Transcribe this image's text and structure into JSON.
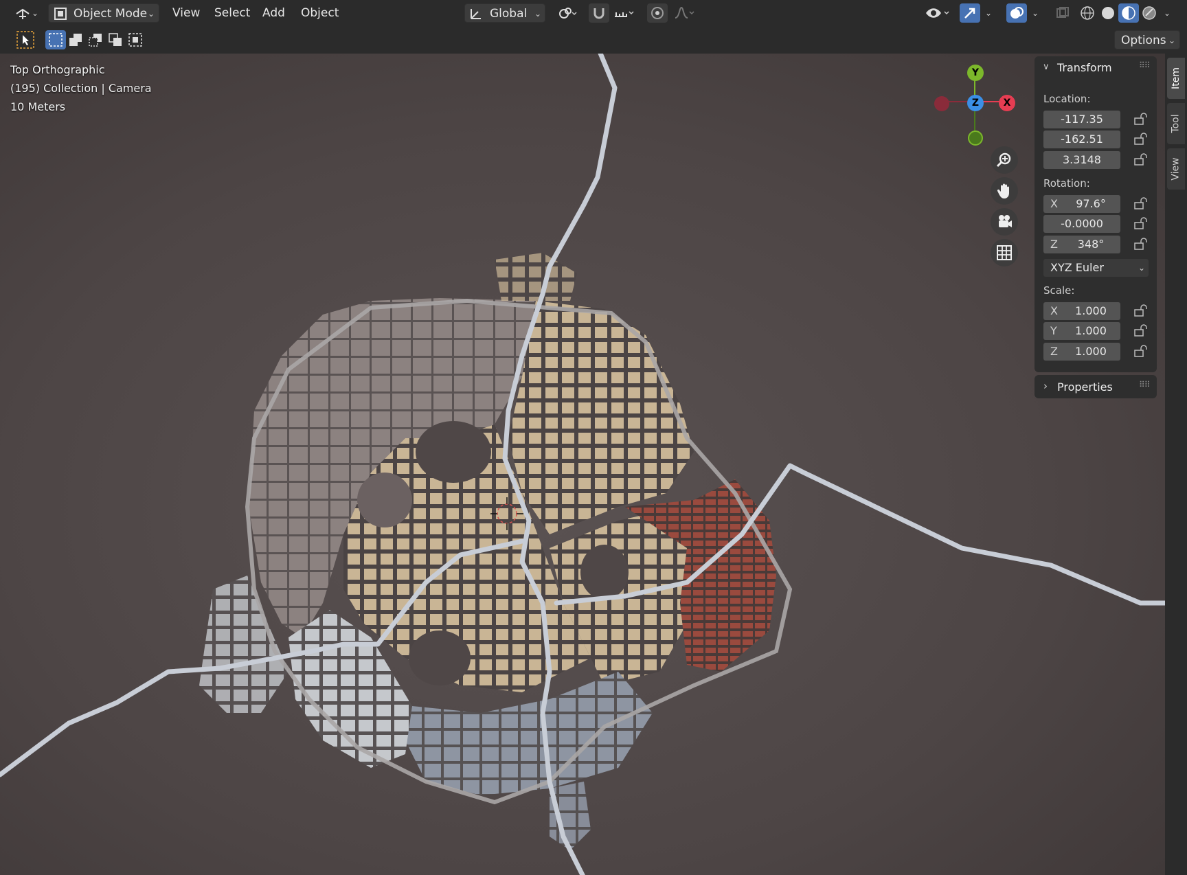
{
  "header": {
    "mode": "Object Mode",
    "menus": [
      "View",
      "Select",
      "Add",
      "Object"
    ],
    "orientation": "Global"
  },
  "toolbar": {
    "options": "Options"
  },
  "viewport": {
    "view_name": "Top Orthographic",
    "collection": "(195) Collection | Camera",
    "scale": "10 Meters"
  },
  "gizmo": {
    "y": "Y",
    "z": "Z",
    "x": "X"
  },
  "npanel": {
    "title": "Transform",
    "location_label": "Location:",
    "location": [
      "-117.35",
      "-162.51",
      "3.3148"
    ],
    "rotation_label": "Rotation:",
    "rotation": [
      {
        "axis": "X",
        "value": "97.6°"
      },
      {
        "axis": "",
        "value": "-0.0000"
      },
      {
        "axis": "Z",
        "value": "348°"
      }
    ],
    "rotation_mode": "XYZ Euler",
    "scale_label": "Scale:",
    "scale": [
      {
        "axis": "X",
        "value": "1.000"
      },
      {
        "axis": "Y",
        "value": "1.000"
      },
      {
        "axis": "Z",
        "value": "1.000"
      }
    ],
    "properties": "Properties"
  },
  "side_tabs": [
    "Item",
    "Tool",
    "View"
  ],
  "colors": {
    "header_bg": "#2b2b2b",
    "accent": "#4772b3",
    "axis_x": "#e63d52",
    "axis_y": "#7cb82b",
    "axis_z": "#3b8fe6"
  }
}
